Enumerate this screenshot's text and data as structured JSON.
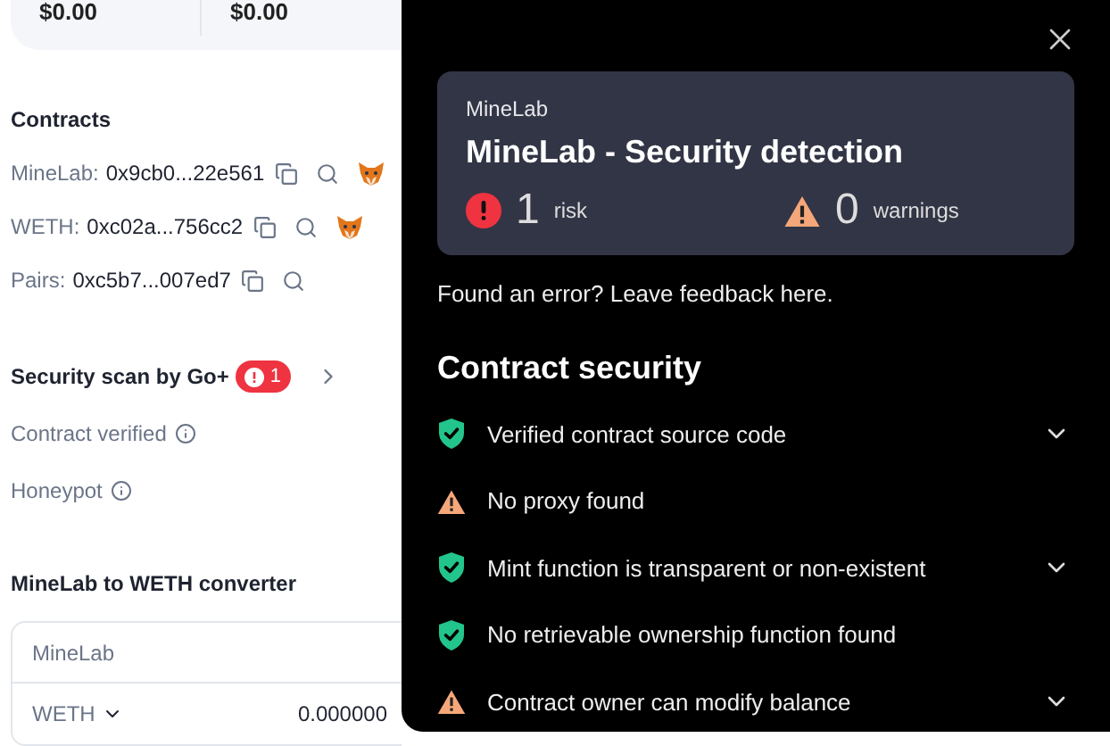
{
  "summary": {
    "values": [
      "$0.00",
      "$0.00"
    ]
  },
  "contracts": {
    "title": "Contracts",
    "items": [
      {
        "label": "MineLab:",
        "address": "0x9cb0...22e561",
        "wallet": true
      },
      {
        "label": "WETH:",
        "address": "0xc02a...756cc2",
        "wallet": true
      },
      {
        "label": "Pairs:",
        "address": "0xc5b7...007ed7",
        "wallet": false
      }
    ]
  },
  "security_scan": {
    "label": "Security scan by Go+",
    "badge": "1"
  },
  "checks": [
    {
      "label": "Contract verified"
    },
    {
      "label": "Honeypot"
    }
  ],
  "converter": {
    "title": "MineLab to WETH converter",
    "from": "MineLab",
    "to": "WETH",
    "amount": "0.000000"
  },
  "panel": {
    "subtitle": "MineLab",
    "title": "MineLab - Security detection",
    "risk": {
      "count": "1",
      "label": "risk"
    },
    "warnings": {
      "count": "0",
      "label": "warnings"
    },
    "feedback": "Found an error? Leave feedback here.",
    "section": "Contract security",
    "items": [
      {
        "kind": "pass",
        "label": "Verified contract source code",
        "expandable": true
      },
      {
        "kind": "warning",
        "label": "No proxy found",
        "expandable": false
      },
      {
        "kind": "pass",
        "label": "Mint function is transparent or non-existent",
        "expandable": true
      },
      {
        "kind": "pass",
        "label": "No retrievable ownership function found",
        "expandable": false
      },
      {
        "kind": "warning",
        "label": "Contract owner can modify balance",
        "expandable": true
      }
    ]
  }
}
